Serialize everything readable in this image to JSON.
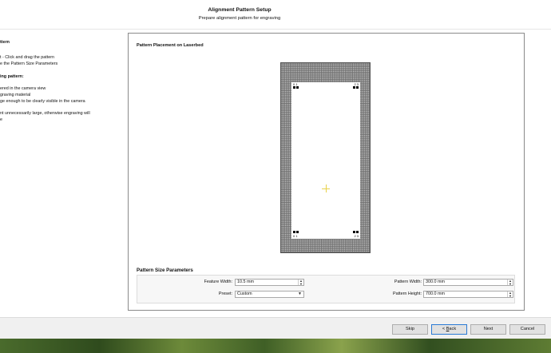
{
  "header": {
    "title": "Alignment Pattern Setup",
    "subtitle": "Prepare alignment pattern for engraving"
  },
  "instructions": {
    "heading1": "ttern",
    "line1": "t - Click and drag the pattern",
    "line2": "e the Pattern Size Parameters",
    "heading2": "ing pattern:",
    "line3": "ered in the camera view",
    "line4": "graving material",
    "line5": "ge enough to be clearly visible in the camera",
    "line6": "nt unnecessarily large, otherwise engraving will",
    "line7": "e"
  },
  "placement": {
    "title": "Pattern Placement on Laserbed",
    "marker_tl": "0 1",
    "marker_tr": "2 3",
    "marker_bl": "0 1",
    "marker_br": "2 3"
  },
  "params": {
    "title": "Pattern Size Parameters",
    "feature_width_label": "Feature Width:",
    "feature_width_value": "10.5 mm",
    "preset_label": "Preset:",
    "preset_value": "Custom",
    "pattern_width_label": "Pattern Width:",
    "pattern_width_value": "300.0 mm",
    "pattern_height_label": "Pattern Height:",
    "pattern_height_value": "700.0 mm"
  },
  "buttons": {
    "skip": "Skip",
    "back_prefix": "< ",
    "back_mnemonic": "B",
    "back_rest": "ack",
    "next": "Next",
    "cancel": "Cancel"
  }
}
